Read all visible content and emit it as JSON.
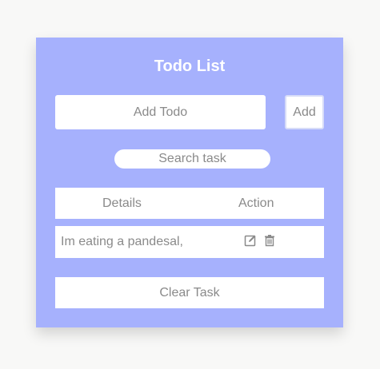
{
  "app": {
    "title": "Todo List"
  },
  "add": {
    "placeholder": "Add Todo",
    "button_label": "Add"
  },
  "search": {
    "placeholder": "Search task"
  },
  "table": {
    "headers": [
      "Details",
      "Action"
    ],
    "rows": [
      {
        "details": "Im eating a pandesal,",
        "actions": [
          "edit-icon",
          "trash-icon"
        ]
      }
    ]
  },
  "footer": {
    "clear_label": "Clear Task"
  },
  "colors": {
    "card_bg": "#a6b1fd",
    "page_bg": "#f8f8f7",
    "text_muted": "#8a8a8a"
  }
}
